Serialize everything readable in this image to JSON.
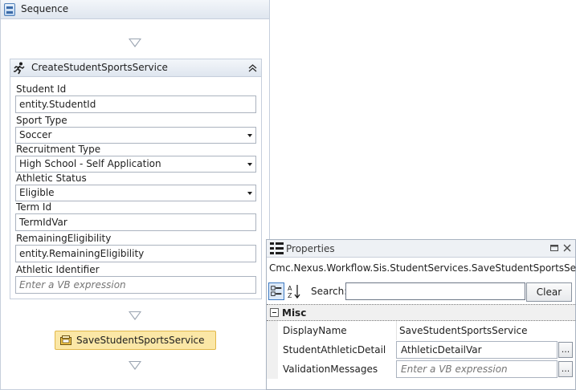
{
  "sequence": {
    "title": "Sequence",
    "icon": "sequence-icon"
  },
  "create_activity": {
    "title": "CreateStudentSportsService",
    "icon": "runner-icon",
    "collapse_icon": "double-chevron-up-icon",
    "fields": {
      "student_id": {
        "label": "Student Id",
        "value": "entity.StudentId"
      },
      "sport_type": {
        "label": "Sport Type",
        "value": "Soccer"
      },
      "recruitment_type": {
        "label": "Recruitment Type",
        "value": "High School - Self Application"
      },
      "athletic_status": {
        "label": "Athletic Status",
        "value": "Eligible"
      },
      "term_id": {
        "label": "Term Id",
        "value": "TermIdVar"
      },
      "remaining_eligibility": {
        "label": "RemainingEligibility",
        "value": "entity.RemainingEligibility"
      },
      "athletic_identifier": {
        "label": "Athletic Identifier",
        "placeholder": "Enter a VB expression"
      }
    }
  },
  "save_activity": {
    "title": "SaveStudentSportsService",
    "icon": "activity-icon",
    "color": "#fbe7a6"
  },
  "properties": {
    "title": "Properties",
    "type_name": "Cmc.Nexus.Workflow.Sis.StudentServices.SaveStudentSportsService",
    "search_label": "Search:",
    "search_value": "",
    "clear_label": "Clear",
    "category": "Misc",
    "rows": [
      {
        "name": "DisplayName",
        "value": "SaveStudentSportsService"
      },
      {
        "name": "StudentAthleticDetail",
        "value": "AthleticDetailVar",
        "button": "..."
      },
      {
        "name": "ValidationMessages",
        "placeholder": "Enter a VB expression",
        "button": "..."
      }
    ]
  }
}
